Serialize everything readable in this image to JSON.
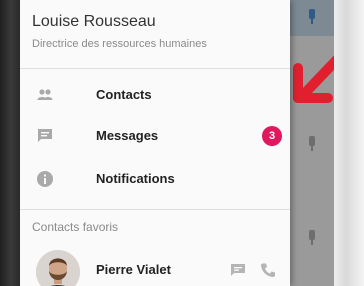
{
  "user": {
    "name": "Louise Rousseau",
    "role": "Directrice des ressources humaines"
  },
  "nav": [
    {
      "label": "Contacts",
      "icon": "people-icon"
    },
    {
      "label": "Messages",
      "icon": "message-icon",
      "badge": "3"
    },
    {
      "label": "Notifications",
      "icon": "info-icon"
    }
  ],
  "favorites": {
    "title": "Contacts favoris",
    "contacts": [
      {
        "name": "Pierre Vialet",
        "actions": [
          "message-icon",
          "phone-icon"
        ]
      }
    ]
  },
  "colors": {
    "badge": "#e0195f",
    "arrow": "#e0202f",
    "pin_active": "#2f5b86"
  }
}
